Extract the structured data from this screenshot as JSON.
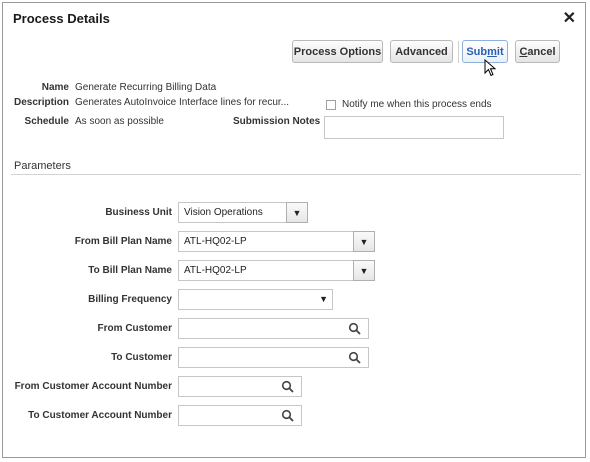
{
  "dialog": {
    "title": "Process Details",
    "close_glyph": "✕"
  },
  "toolbar": {
    "process_options_label": "Process Options",
    "advanced_label": "Advanced",
    "submit_prefix": "Sub",
    "submit_mnemonic": "m",
    "submit_suffix": "it",
    "cancel_mnemonic": "C",
    "cancel_suffix": "ancel"
  },
  "info": {
    "name_label": "Name",
    "name_value": "Generate Recurring Billing Data",
    "description_label": "Description",
    "description_value": "Generates AutoInvoice Interface lines for recur...",
    "schedule_label": "Schedule",
    "schedule_value": "As soon as possible",
    "notify_label": "Notify me when this process ends",
    "notify_checked": false,
    "submission_notes_label": "Submission Notes",
    "submission_notes_value": ""
  },
  "parameters": {
    "section_title": "Parameters",
    "business_unit_label": "Business Unit",
    "business_unit_value": "Vision Operations",
    "from_bill_plan_label": "From Bill Plan Name",
    "from_bill_plan_value": "ATL-HQ02-LP",
    "to_bill_plan_label": "To Bill Plan Name",
    "to_bill_plan_value": "ATL-HQ02-LP",
    "billing_frequency_label": "Billing Frequency",
    "billing_frequency_value": "",
    "from_customer_label": "From Customer",
    "from_customer_value": "",
    "to_customer_label": "To Customer",
    "to_customer_value": "",
    "from_account_label": "From Customer Account Number",
    "from_account_value": "",
    "to_account_label": "To Customer Account Number",
    "to_account_value": ""
  },
  "icons": {
    "dropdown": "▼",
    "caret": "▼",
    "search": "search-icon",
    "pointer": "mouse-pointer-icon"
  }
}
